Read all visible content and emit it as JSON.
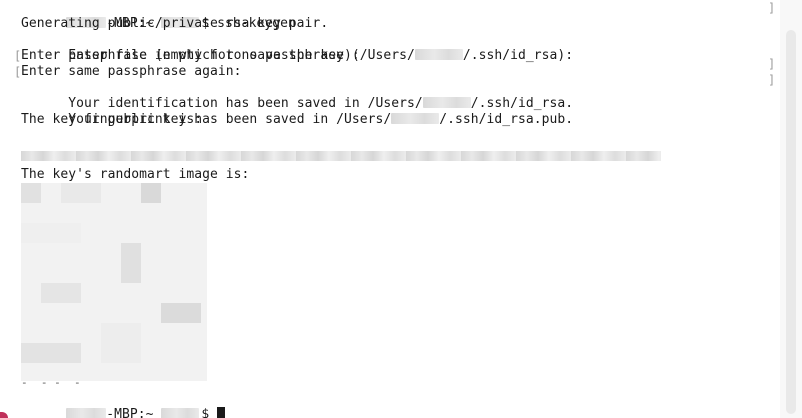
{
  "terminal": {
    "lines": [
      "-MBP:~ ",
      "$ ssh-keygen",
      "Generating public/private rsa key pair.",
      "Enter file in which to save the key (/Users/",
      "/.ssh/id_rsa):",
      "Enter passphrase (empty for no passphrase):",
      "Enter same passphrase again:",
      "Your identification has been saved in /Users/",
      "/.ssh/id_rsa.",
      "Your public key has been saved in /Users/",
      "/.ssh/id_rsa.pub.",
      "The key fingerprint is:",
      "The key's randomart image is:",
      "-MBP:~ ",
      "$"
    ],
    "randomart_dashes": "-  - -  -",
    "brackets": [
      "]",
      "[",
      "]",
      "[",
      "]"
    ]
  }
}
